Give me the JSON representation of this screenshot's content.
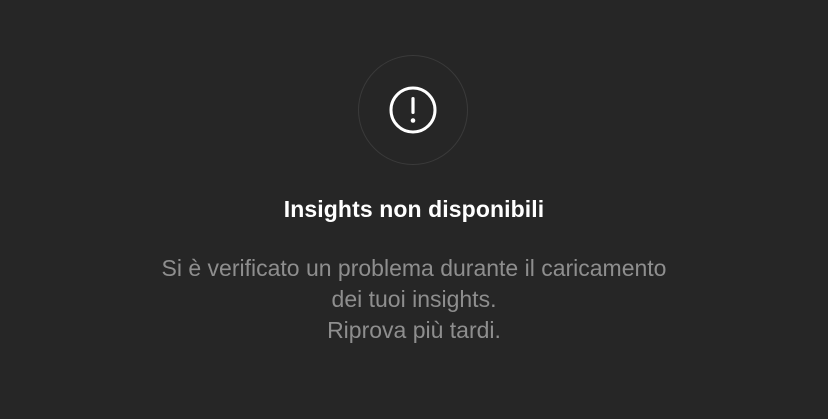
{
  "empty_state": {
    "icon": "exclamation-circle-icon",
    "title": "Insights non disponibili",
    "message_lines": [
      "Si è verificato un problema durante il caricamento",
      "dei tuoi insights.",
      "Riprova più tardi."
    ]
  },
  "colors": {
    "background": "#262626",
    "title_text": "#ffffff",
    "message_text": "#8e8e8e",
    "icon_ring": "#3a3a3a",
    "icon": "#ffffff"
  }
}
